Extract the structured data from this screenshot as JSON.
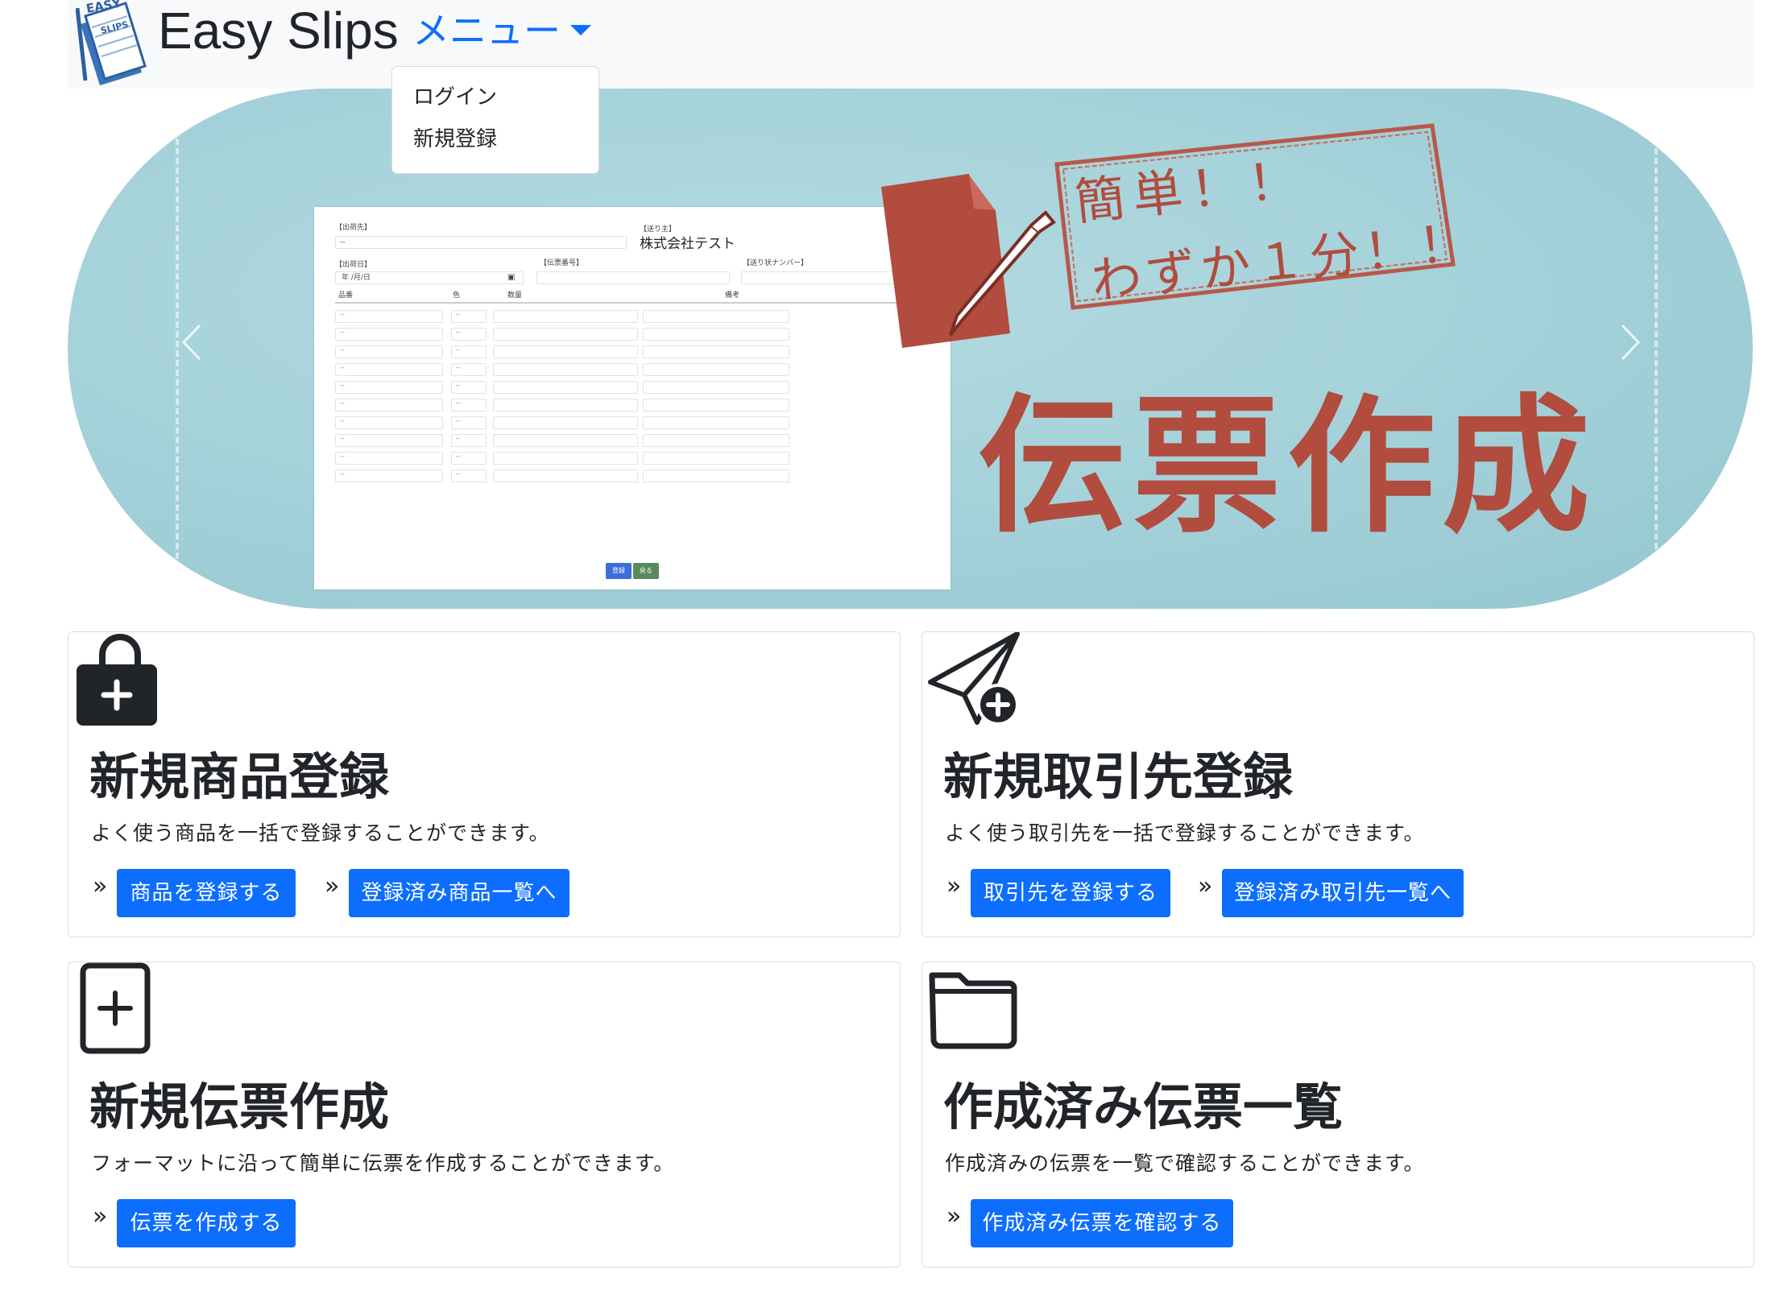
{
  "navbar": {
    "brand": "Easy Slips",
    "logo_text_top": "EASY",
    "logo_text_bottom": "SLIPS",
    "menu_label": "メニュー",
    "dropdown": {
      "items": [
        "ログイン",
        "新規登録"
      ]
    }
  },
  "hero": {
    "stamp_line1": "簡単！！",
    "stamp_line2": "わずか１分！！",
    "title": "伝票作成",
    "mockup": {
      "ship_from_label": "【出荷先】",
      "send_to_label": "【送り主】",
      "send_to_value": "株式会社テスト",
      "ship_date_label": "【出荷日】",
      "date_placeholder": "年 /月/日",
      "slip_no_label": "【伝票番号】",
      "tracking_label": "【送り状ナンバー】",
      "col_product": "品番",
      "col_color": "色",
      "col_qty": "数量",
      "col_note": "備考",
      "dash": "--",
      "btn_register": "登録",
      "btn_back": "戻る"
    }
  },
  "cards": [
    {
      "icon": "bag-plus-icon",
      "title": "新規商品登録",
      "text": "よく使う商品を一括で登録することができます。",
      "buttons": [
        "商品を登録する",
        "登録済み商品一覧へ"
      ]
    },
    {
      "icon": "send-plus-icon",
      "title": "新規取引先登録",
      "text": "よく使う取引先を一括で登録することができます。",
      "buttons": [
        "取引先を登録する",
        "登録済み取引先一覧へ"
      ]
    },
    {
      "icon": "file-plus-icon",
      "title": "新規伝票作成",
      "text": "フォーマットに沿って簡単に伝票を作成することができます。",
      "buttons": [
        "伝票を作成する"
      ]
    },
    {
      "icon": "folder-icon",
      "title": "作成済み伝票一覧",
      "text": "作成済みの伝票を一覧で確認することができます。",
      "buttons": [
        "作成済み伝票を確認する"
      ]
    }
  ],
  "chevron_symbol": "»",
  "colors": {
    "primary": "#0d6efd",
    "hero_bg": "#a4d1d9",
    "accent_red": "#b14c3e",
    "navbar_bg": "#f8f9fa"
  }
}
